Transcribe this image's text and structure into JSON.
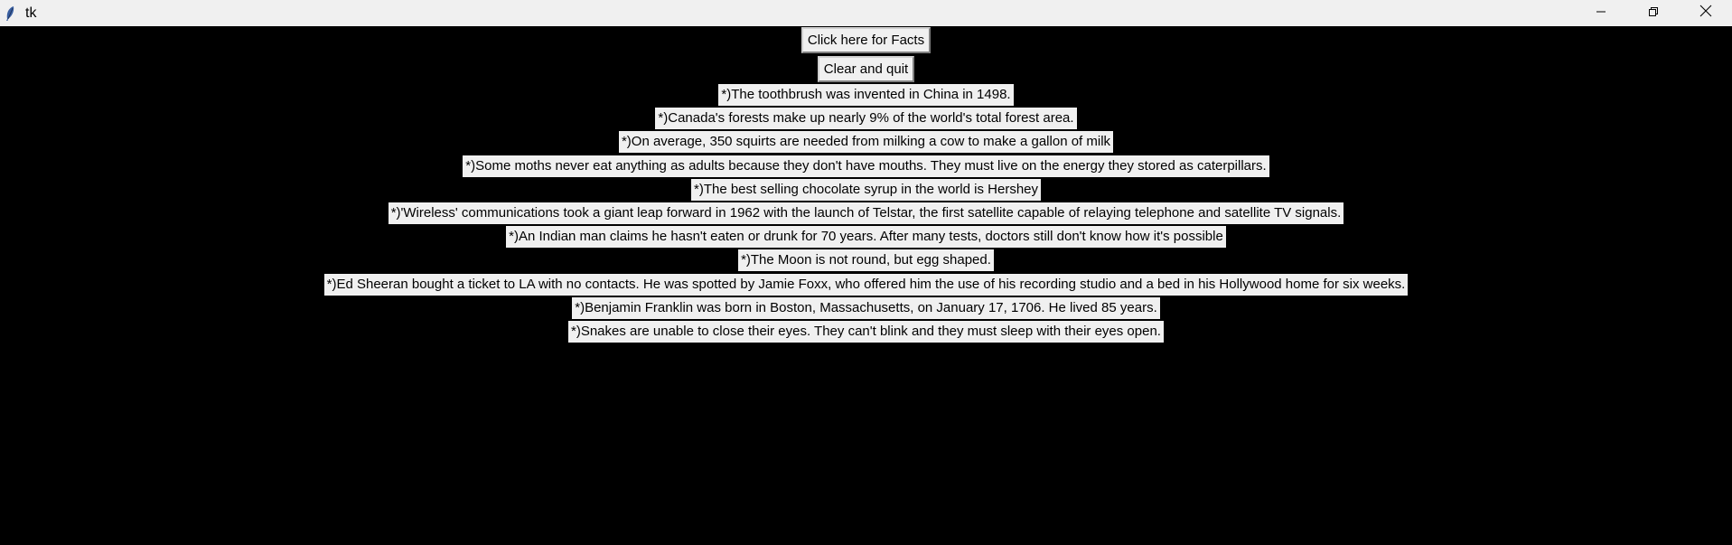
{
  "window": {
    "title": "tk",
    "controls": [
      "minimize-icon",
      "restore-icon",
      "close-icon"
    ]
  },
  "buttons": {
    "facts_label": "Click here for Facts",
    "quit_label": "Clear and quit"
  },
  "facts": [
    "*)The toothbrush was invented in China in 1498.",
    "*)Canada's forests make up nearly 9% of the world's total forest area.",
    "*)On average, 350 squirts are needed from milking a cow to make a gallon of milk",
    "*)Some moths never eat anything as adults because they don't have mouths. They must live on the energy they stored as caterpillars.",
    "*)The best selling chocolate syrup in the world is Hershey",
    "*)'Wireless' communications took a giant leap forward in 1962 with the launch of Telstar, the first satellite capable of relaying telephone and satellite TV signals.",
    "*)An Indian man claims he hasn't eaten or drunk for 70 years. After many tests, doctors still don't know how it's possible",
    "*)The Moon is not round, but egg shaped.",
    "*)Ed Sheeran bought a ticket to LA with no contacts. He was spotted by Jamie Foxx, who offered him the use of his recording studio and a bed in his Hollywood home for six weeks.",
    "*)Benjamin Franklin was born in Boston, Massachusetts, on January 17, 1706. He lived 85 years.",
    "*)Snakes are unable to close their eyes. They can't blink and they must sleep with their eyes open."
  ],
  "colors": {
    "background": "#000000",
    "chrome": "#f0f0f0",
    "label_bg": "#f0f0f0",
    "text": "#000000"
  }
}
